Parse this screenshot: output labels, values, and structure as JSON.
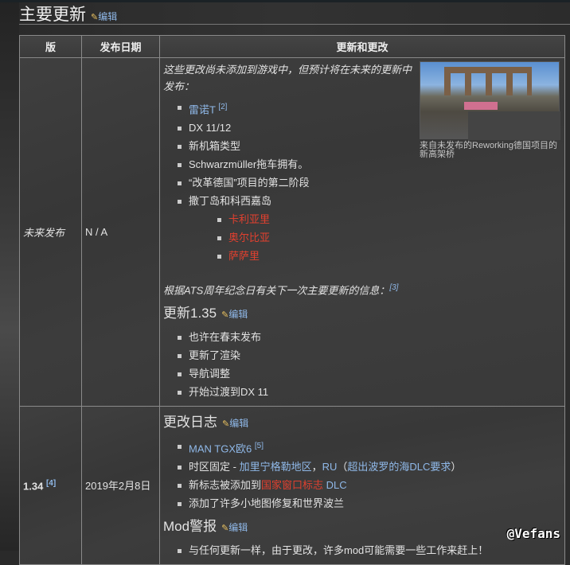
{
  "section": {
    "title": "主要更新",
    "edit": "编辑"
  },
  "table": {
    "headers": [
      "版",
      "发布日期",
      "更新和更改"
    ],
    "rows": [
      {
        "version": "未来发布",
        "date": "N / A",
        "intro": "这些更改尚未添加到游戏中，但预计将在未来的更新中发布：",
        "image_caption": "来自未发布的Reworking德国项目的新高架桥",
        "items": [
          {
            "text": "雷诺T",
            "ref": "[2]"
          },
          {
            "text": "DX 11/12"
          },
          {
            "text": "新机箱类型"
          },
          {
            "text": "Schwarzmüller拖车拥有。"
          },
          {
            "text": "“改革德国”项目的第二阶段"
          },
          {
            "text": "撒丁岛和科西嘉岛"
          }
        ],
        "subitems": [
          "卡利亚里",
          "奥尔比亚",
          "萨萨里"
        ],
        "note": "根据ATS周年纪念日有关下一次主要更新的信息：",
        "note_ref": "[3]",
        "subheading": "更新1.35",
        "edit": "编辑",
        "items2": [
          "也许在春末发布",
          "更新了渲染",
          "导航调整",
          "开始过渡到DX 11"
        ]
      },
      {
        "version": "1.34",
        "version_ref": "[4]",
        "date": "2019年2月8日",
        "changelog_title": "更改日志",
        "edit": "编辑",
        "c1": "MAN TGX欧6",
        "c1_ref": "[5]",
        "c2_pre": "时区固定 - ",
        "c2_link1": "加里宁格勒地区",
        "c2_mid": "，",
        "c2_link2": "RU",
        "c2_p": "（",
        "c2_link3": "超出波罗的海DLC要求",
        "c2_end": "）",
        "c3_pre": "新标志被添加到",
        "c3_link": "国家窗口标志",
        "c3_dlc": " DLC",
        "c4": "添加了许多小地图修复和世界波兰",
        "mod_title": "Mod警报",
        "mod_item": "与任何更新一样，由于更改，许多mod可能需要一些工作来赶上！"
      }
    ]
  },
  "watermark": "@Vefans"
}
